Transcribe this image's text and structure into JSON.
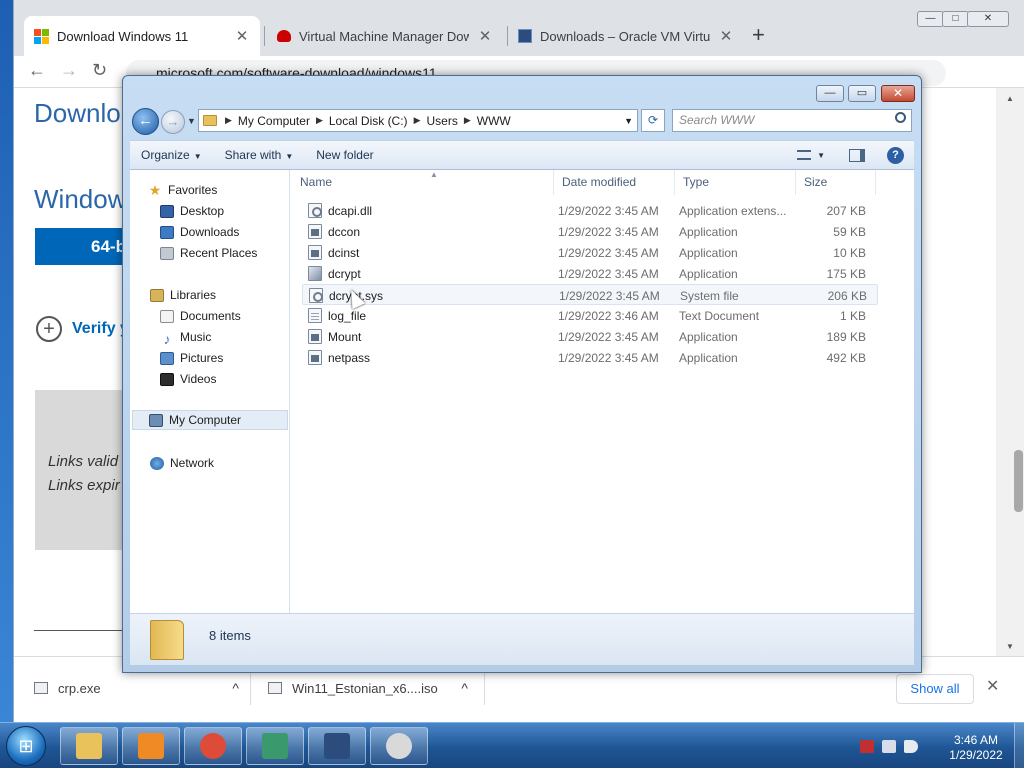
{
  "browser": {
    "tabs": [
      {
        "title": "Download Windows 11",
        "favicon": "windows-logo-icon",
        "active": true
      },
      {
        "title": "Virtual Machine Manager Downl",
        "favicon": "redhat-icon",
        "active": false
      },
      {
        "title": "Downloads – Oracle VM VirtualB",
        "favicon": "virtualbox-icon",
        "active": false
      }
    ],
    "close_glyph": "✕",
    "new_tab_glyph": "+",
    "url": "microsoft.com/software-download/windows11",
    "window_buttons": {
      "minimize": "—",
      "maximize": "□",
      "close": "✕"
    },
    "nav": {
      "back": "←",
      "forward": "→",
      "reload": "↻"
    }
  },
  "page": {
    "heading1": "Downloa",
    "heading2": "Window",
    "download_button": "64-b",
    "verify_link": "Verify y",
    "verify_plus": "+",
    "links_line1": "Links valid",
    "links_line2": "Links expir"
  },
  "downloads_bar": {
    "items": [
      {
        "name": "crp.exe",
        "chevron": "^"
      },
      {
        "name": "Win11_Estonian_x6....iso",
        "chevron": "^"
      }
    ],
    "show_all": "Show all",
    "close": "✕"
  },
  "explorer": {
    "window_buttons": {
      "minimize": "—",
      "maximize": "▭",
      "close": "✕"
    },
    "nav": {
      "back": "←",
      "forward": "→",
      "history": "▼"
    },
    "breadcrumb": [
      "My Computer",
      "Local Disk (C:)",
      "Users",
      "WWW"
    ],
    "breadcrumb_sep": "▶",
    "address_dropdown": "▼",
    "refresh": "⟳",
    "search_placeholder": "Search WWW",
    "commands": {
      "organize": "Organize",
      "share_with": "Share with",
      "new_folder": "New folder",
      "caret": "▼"
    },
    "nav_pane": {
      "favorites": "Favorites",
      "favorites_items": [
        "Desktop",
        "Downloads",
        "Recent Places"
      ],
      "libraries": "Libraries",
      "library_items": [
        "Documents",
        "Music",
        "Pictures",
        "Videos"
      ],
      "computer": "My Computer",
      "network": "Network"
    },
    "columns": {
      "name": "Name",
      "date": "Date modified",
      "type": "Type",
      "size": "Size",
      "sort_indicator": "▲"
    },
    "files": [
      {
        "name": "dcapi.dll",
        "date": "1/29/2022 3:45 AM",
        "type": "Application extens...",
        "size": "207 KB",
        "icon": "gear"
      },
      {
        "name": "dccon",
        "date": "1/29/2022 3:45 AM",
        "type": "Application",
        "size": "59 KB",
        "icon": "app"
      },
      {
        "name": "dcinst",
        "date": "1/29/2022 3:45 AM",
        "type": "Application",
        "size": "10 KB",
        "icon": "app"
      },
      {
        "name": "dcrypt",
        "date": "1/29/2022 3:45 AM",
        "type": "Application",
        "size": "175 KB",
        "icon": "dcrypt"
      },
      {
        "name": "dcrypt.sys",
        "date": "1/29/2022 3:45 AM",
        "type": "System file",
        "size": "206 KB",
        "icon": "gear"
      },
      {
        "name": "log_file",
        "date": "1/29/2022 3:46 AM",
        "type": "Text Document",
        "size": "1 KB",
        "icon": "txt"
      },
      {
        "name": "Mount",
        "date": "1/29/2022 3:45 AM",
        "type": "Application",
        "size": "189 KB",
        "icon": "app"
      },
      {
        "name": "netpass",
        "date": "1/29/2022 3:45 AM",
        "type": "Application",
        "size": "492 KB",
        "icon": "app"
      }
    ],
    "status": "8 items",
    "help": "?"
  },
  "taskbar": {
    "start_glyph": "⊞",
    "apps": [
      {
        "name": "explorer-icon",
        "color": "#e9c25c"
      },
      {
        "name": "media-player-icon",
        "color": "#f08a24"
      },
      {
        "name": "chrome-icon",
        "color": "#dd4b39"
      },
      {
        "name": "installer-icon",
        "color": "#3a9a6e"
      },
      {
        "name": "virtualbox-icon",
        "color": "#2d4c7e"
      },
      {
        "name": "disc-icon",
        "color": "#d9d9d9"
      }
    ],
    "time": "3:46 AM",
    "date": "1/29/2022"
  }
}
